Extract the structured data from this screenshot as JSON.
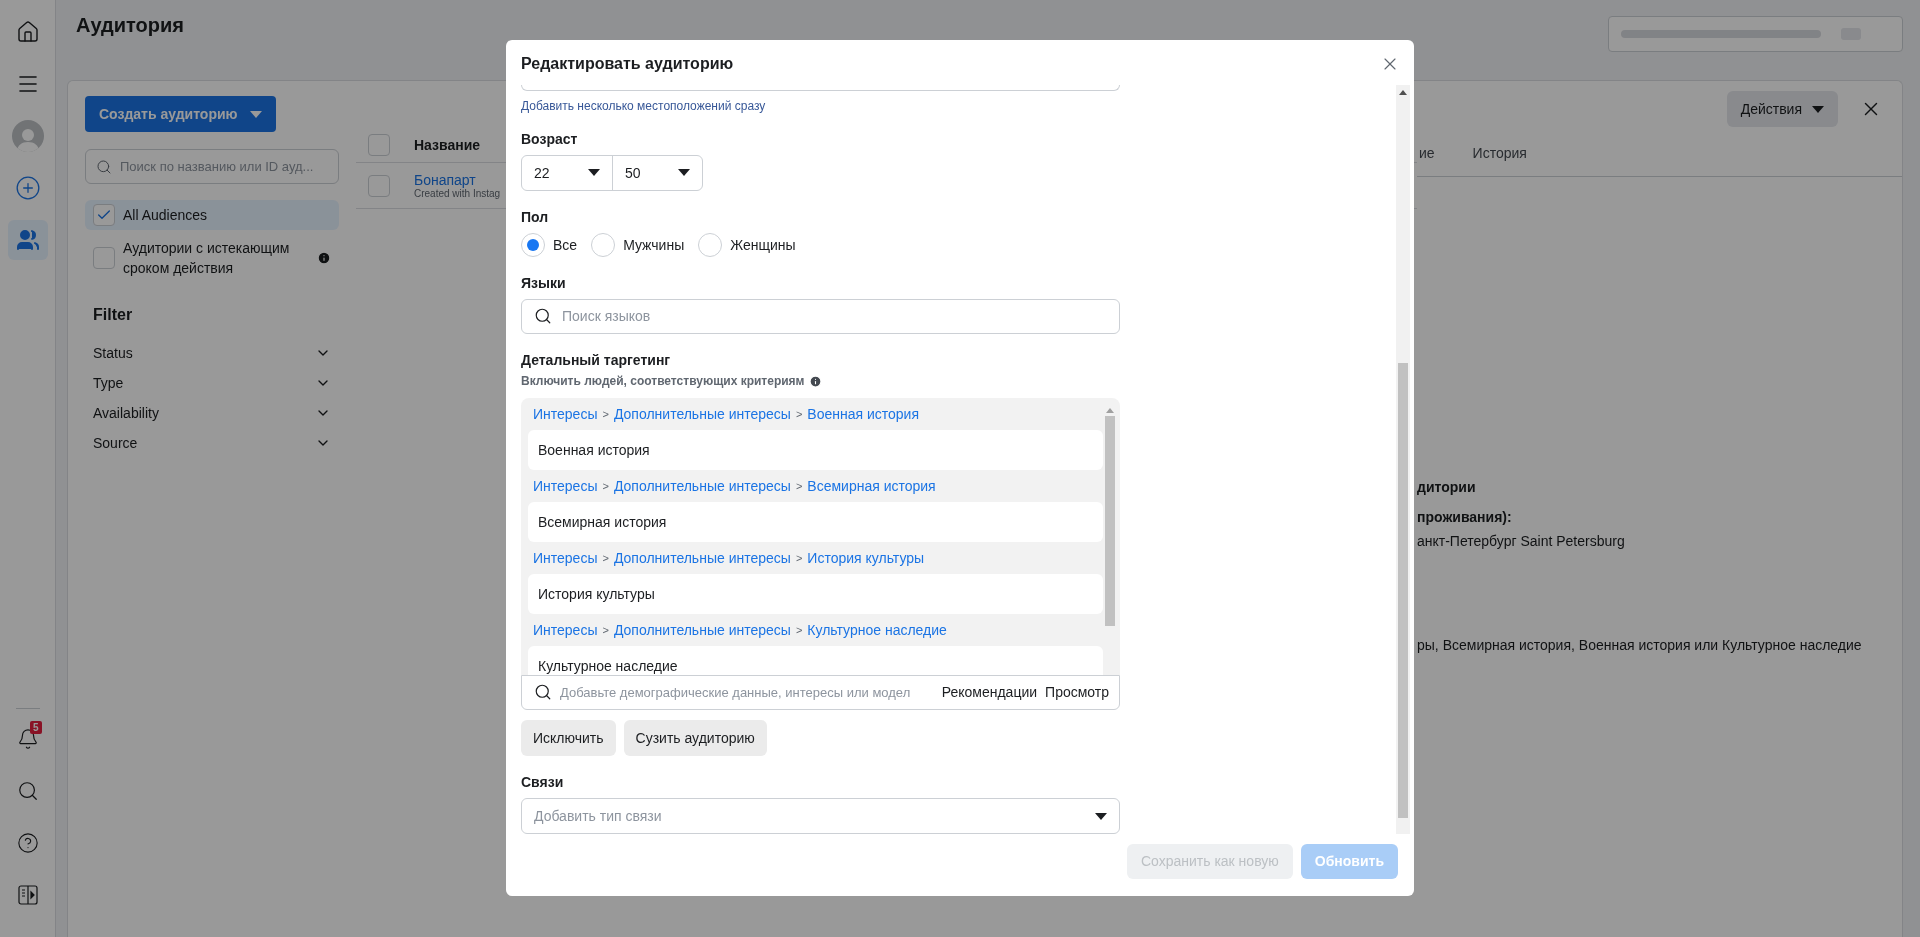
{
  "nav": {
    "items": [
      {
        "kind": "home",
        "selected": false
      },
      {
        "kind": "menu",
        "selected": false
      },
      {
        "kind": "avatar",
        "selected": false
      },
      {
        "kind": "create",
        "selected": false
      },
      {
        "kind": "audiences",
        "selected": true
      }
    ],
    "bottom_items": [
      {
        "kind": "notifications",
        "badge": "5"
      },
      {
        "kind": "search"
      },
      {
        "kind": "help"
      },
      {
        "kind": "panel"
      }
    ]
  },
  "page": {
    "title": "Аудитория"
  },
  "audiences_panel": {
    "create_button": "Создать аудиторию",
    "search_placeholder": "Поиск по названию или ID ауд...",
    "lists": [
      {
        "label": "All Audiences",
        "checked": true,
        "selected": true
      },
      {
        "label": "Аудитории с истекающим сроком действия",
        "checked": false,
        "selected": false,
        "info": true
      }
    ],
    "filter": {
      "title": "Filter",
      "items": [
        {
          "label": "Status",
          "expanded": false
        },
        {
          "label": "Type",
          "expanded": false
        },
        {
          "label": "Availability",
          "expanded": false
        },
        {
          "label": "Source",
          "expanded": false
        }
      ]
    }
  },
  "table": {
    "header_checked": false,
    "columns": [
      "Название"
    ],
    "rows": [
      {
        "name": "Бонапарт",
        "subtitle": "Created with Instag",
        "checked": false
      }
    ]
  },
  "details": {
    "actions_button": "Действия",
    "tabs": [
      {
        "label": "ие",
        "selected": false
      },
      {
        "label": "История",
        "selected": false
      }
    ],
    "lines": [
      {
        "kind": "heading",
        "text": "дитории"
      },
      {
        "kind": "label",
        "text": "проживания):"
      },
      {
        "kind": "value",
        "text": "анкт-Петербург Saint Petersburg"
      },
      {
        "kind": "gap"
      },
      {
        "kind": "value",
        "text": "ры, Всемирная история, Военная история или Культурное наследие"
      }
    ]
  },
  "modal": {
    "title": "Редактировать аудиторию",
    "location_link": "Добавить несколько местоположений сразу",
    "age": {
      "label": "Возраст",
      "from": "22",
      "to": "50"
    },
    "gender": {
      "label": "Пол",
      "options": [
        {
          "label": "Все",
          "selected": true
        },
        {
          "label": "Мужчины",
          "selected": false
        },
        {
          "label": "Женщины",
          "selected": false
        }
      ]
    },
    "languages": {
      "label": "Языки",
      "placeholder": "Поиск языков"
    },
    "detailed_targeting": {
      "label": "Детальный таргетинг",
      "subtitle": "Включить людей, соответствующих критериям",
      "separator": ">",
      "items": [
        {
          "path": [
            "Интересы",
            "Дополнительные интересы",
            "Военная история"
          ],
          "name": "Военная история"
        },
        {
          "path": [
            "Интересы",
            "Дополнительные интересы",
            "Всемирная история"
          ],
          "name": "Всемирная история"
        },
        {
          "path": [
            "Интересы",
            "Дополнительные интересы",
            "История культуры"
          ],
          "name": "История культуры"
        },
        {
          "path": [
            "Интересы",
            "Дополнительные интересы",
            "Культурное наследие"
          ],
          "name": "Культурное наследие"
        }
      ],
      "search_placeholder": "Добавьте демографические данные, интересы или модел",
      "suggestions_link": "Рекомендации",
      "browse_link": "Просмотр",
      "buttons": [
        "Исключить",
        "Сузить аудиторию"
      ]
    },
    "connections": {
      "label": "Связи",
      "placeholder": "Добавить тип связи"
    },
    "footer": [
      {
        "kind": "secondary",
        "label": "Сохранить как новую",
        "disabled": true
      },
      {
        "kind": "primary",
        "label": "Обновить",
        "disabled": true
      }
    ]
  }
}
